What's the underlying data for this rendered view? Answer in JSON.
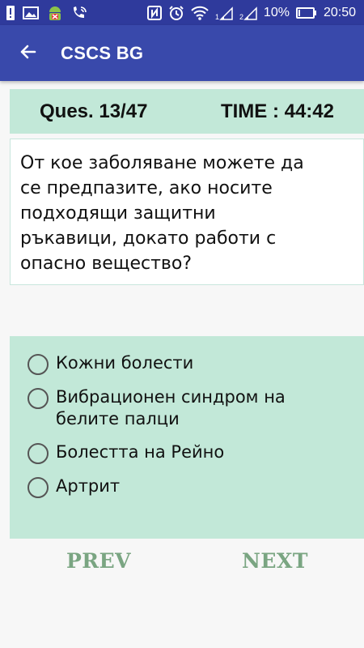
{
  "status_bar": {
    "icons_left": [
      "alert-icon",
      "image-icon",
      "android-bug-icon",
      "wifi-call-icon"
    ],
    "icons_right": [
      "nfc-icon",
      "alarm-icon",
      "wifi-icon",
      "signal-1-icon",
      "signal-2-icon",
      "battery-icon"
    ],
    "signal_1_label": "1",
    "signal_2_label": "2",
    "battery_percent": "10%",
    "time": "20:50",
    "colors": {
      "bar": "#2f3a9c"
    }
  },
  "app_bar": {
    "title": "CSCS BG",
    "back_icon": "arrow-left-icon",
    "colors": {
      "bar": "#3949ab"
    }
  },
  "quiz": {
    "question_counter": "Ques. 13/47",
    "timer": "TIME : 44:42",
    "question": "От кое заболяване можете да се предпазите, ако носите подходящи защитни ръкавици, докато работи с опасно вещество?",
    "options": [
      {
        "label": "Кожни болести",
        "selected": false
      },
      {
        "label": "Вибрационен синдром на белите палци",
        "selected": false
      },
      {
        "label": "Болестта на Рейно",
        "selected": false
      },
      {
        "label": "Артрит",
        "selected": false
      }
    ],
    "colors": {
      "panel": "#c2e8d8",
      "nav_text": "#7aa582"
    }
  },
  "navigation": {
    "prev_label": "PREV",
    "next_label": "NEXT"
  }
}
